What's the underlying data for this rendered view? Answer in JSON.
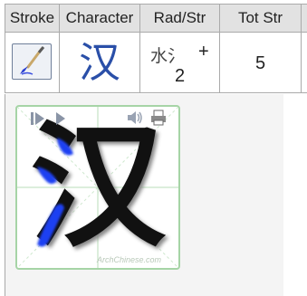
{
  "table": {
    "headers": [
      "Stroke",
      "Character",
      "Rad/Str",
      "Tot Str"
    ],
    "character": "汉",
    "radical": "水氵",
    "radical_plus": "+",
    "radical_strokes": "2",
    "total_strokes": "5"
  },
  "icons": {
    "stroke_button": "brush-icon",
    "play_step": "step-forward-icon",
    "play": "play-icon",
    "sound": "speaker-icon",
    "print": "printer-icon"
  },
  "animation": {
    "character": "汉",
    "watermark": "ArchChinese.com"
  },
  "colors": {
    "header_bg": "#e2e2e2",
    "character_blue": "#2a4fa8",
    "stroke_highlight": "#1f3ff2",
    "grid_green": "#a6d4a6"
  }
}
